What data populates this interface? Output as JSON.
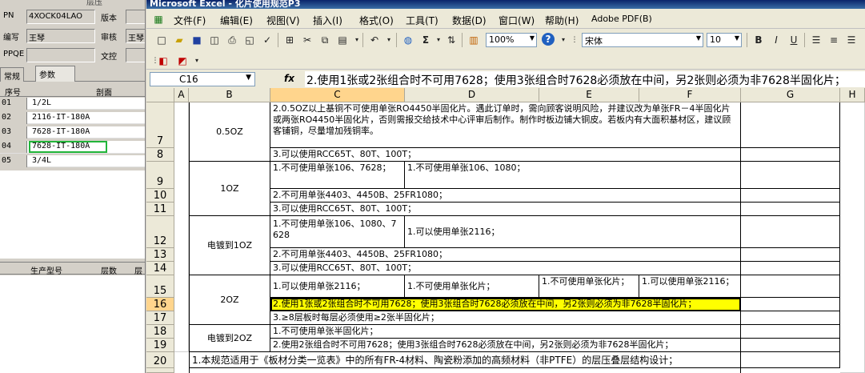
{
  "left_panel": {
    "top_label": "层压",
    "fields": [
      {
        "label": "PN",
        "value": "4XOCK04LAO",
        "label2": "版本",
        "value2": ""
      },
      {
        "label": "编写",
        "value": "王琴",
        "label2": "审核",
        "value2": "王琴"
      },
      {
        "label": "PPQE",
        "value": "",
        "label2": "文控",
        "value2": ""
      }
    ],
    "tabs": [
      "常规",
      "参数"
    ],
    "grid_headers": {
      "no": "序号",
      "section": "剖面"
    },
    "rows": [
      {
        "no": "01",
        "value": "1/2L"
      },
      {
        "no": "02",
        "value": "2116-IT-180A"
      },
      {
        "no": "03",
        "value": "7628-IT-180A"
      },
      {
        "no": "04",
        "value": "7628-IT-180A"
      },
      {
        "no": "05",
        "value": "3/4L"
      }
    ],
    "grid2_headers": {
      "model": "生产型号",
      "layers": "层数",
      "layer": "层"
    }
  },
  "excel": {
    "title": "Microsoft Excel - 化片使用规范P3",
    "menu": [
      "文件(F)",
      "编辑(E)",
      "视图(V)",
      "插入(I)",
      "格式(O)",
      "工具(T)",
      "数据(D)",
      "窗口(W)",
      "帮助(H)",
      "Adobe PDF(B)"
    ],
    "zoom": "100%",
    "font_name": "宋体",
    "font_size": "10",
    "name_box": "C16",
    "fx": "fx",
    "formula": "2.使用1张或2张组合时不可用7628；使用3张组合时7628必须放在中间，另2张则必须为非7628半固化片；",
    "columns": [
      "A",
      "B",
      "C",
      "D",
      "E",
      "F",
      "G",
      "H"
    ],
    "row_numbers": [
      "7",
      "8",
      "9",
      "10",
      "11",
      "12",
      "13",
      "14",
      "15",
      "16",
      "17",
      "18",
      "19",
      "20"
    ],
    "cells": {
      "b_05oz": "0.5OZ",
      "r7_text": "2.0.5OZ以上基铜不可使用单张RO4450半固化片。遇此订单时，需向顾客说明风险，并建议改为单张FR－4半固化片或两张RO4450半固化片，否则需报交给技术中心评审后制作。制作时板边铺大铜皮。若板内有大面积基材区，建议顾客铺铜，尽量增加残铜率。",
      "r8_text": "3.可以使用RCC65T、80T、100T；",
      "b_1oz": "1OZ",
      "r9_c": "1.不可使用单张106、7628；",
      "r9_d": "1.不可使用单张106、1080；",
      "r10_text": "2.不可用单张4403、4450B、25FR1080；",
      "r11_text": "3.可以使用RCC65T、80T、100T；",
      "b_plate1oz": "电镀到1OZ",
      "r12_c": "1.不可使用单张106、1080、7628",
      "r12_d": "1.可以使用单张2116；",
      "r13_text": "2.不可用单张4403、4450B、25FR1080；",
      "r14_text": "3.可以使用RCC65T、80T、100T；",
      "b_2oz": "2OZ",
      "r15_c": "1.可以使用单张2116；",
      "r15_d": "1.不可使用单张化片；",
      "r15_e": "1.不可使用单张化片；",
      "r15_f": "1.可以使用单张2116；",
      "r16_text": "2.使用1张或2张组合时不可用7628；使用3张组合时7628必须放在中间，另2张则必须为非7628半固化片；",
      "r17_text": "3.≥8层板时每层必须使用≥2张半固化片；",
      "b_plate2oz": "电镀到2OZ",
      "r18_text": "1.不可使用单张半固化片；",
      "r19_text": "2.使用2张组合时不可用7628；使用3张组合时7628必须放在中间，另2张则必须为非7628半固化片；",
      "r20_text": "1.本规范适用于《板材分类一览表》中的所有FR-4材料、陶瓷粉添加的高频材料（非PTFE）的层压叠层结构设计；"
    }
  }
}
